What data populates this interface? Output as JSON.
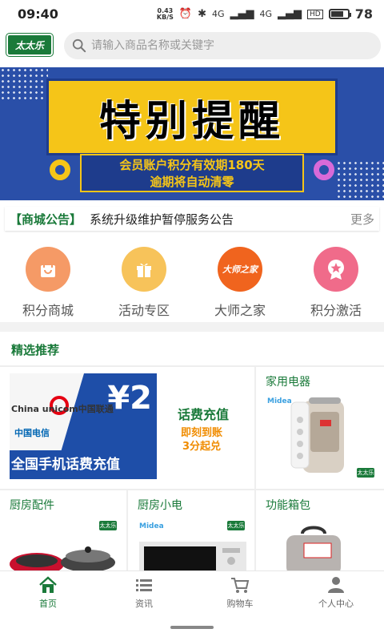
{
  "status_bar": {
    "time": "09:40",
    "speed_top": "0.43",
    "speed_bottom": "KB/S",
    "network_1": "4G",
    "network_2": "4G",
    "hd_label": "HD",
    "battery_percent": 78
  },
  "header": {
    "logo_text": "太太乐",
    "search_placeholder": "请输入商品名称或关键字"
  },
  "banner": {
    "title": "特别提醒",
    "subtitle_line1": "会员账户积分有效期180天",
    "subtitle_line2": "逾期将自动清零"
  },
  "notice": {
    "tag": "【商城公告】",
    "text": "系统升级维护暂停服务公告",
    "more": "更多"
  },
  "quick_nav": [
    {
      "label": "积分商城",
      "icon": "shopping-bag-icon",
      "color": "#f59a66"
    },
    {
      "label": "活动专区",
      "icon": "gift-icon",
      "color": "#f7c35a"
    },
    {
      "label": "大师之家",
      "icon": "master-home-icon",
      "color": "#f0641e",
      "icon_text": "大师之家"
    },
    {
      "label": "积分激活",
      "icon": "star-badge-icon",
      "color": "#f06b8a"
    }
  ],
  "featured": {
    "title": "精选推荐"
  },
  "products": {
    "phone_recharge": {
      "yen": "¥2",
      "carrier_1": "China unicom中国联通",
      "carrier_2": "中国电信",
      "banner_text": "全国手机话费充值",
      "title": "话费充值",
      "sub_line1": "即刻到账",
      "sub_line2": "3分起兑"
    },
    "appliances": {
      "label": "家用电器",
      "brand": "Midea"
    },
    "kitchen_parts": {
      "label": "厨房配件"
    },
    "kitchen_small": {
      "label": "厨房小电",
      "brand": "Midea"
    },
    "bags": {
      "label": "功能箱包"
    },
    "badge_text": "太太乐"
  },
  "bottom_nav": [
    {
      "label": "首页",
      "icon": "home-icon",
      "active": true
    },
    {
      "label": "资讯",
      "icon": "list-icon",
      "active": false
    },
    {
      "label": "购物车",
      "icon": "cart-icon",
      "active": false
    },
    {
      "label": "个人中心",
      "icon": "person-icon",
      "active": false
    }
  ],
  "colors": {
    "brand_green": "#1a7a3a",
    "banner_blue": "#2a4fa8",
    "banner_yellow": "#f5c518"
  }
}
